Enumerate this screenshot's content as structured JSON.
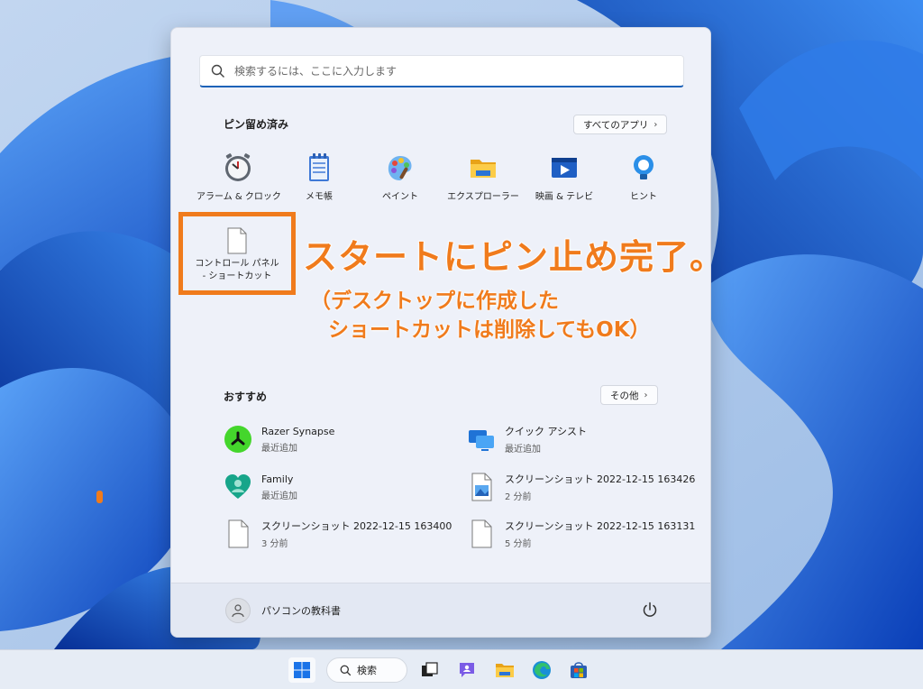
{
  "start_menu": {
    "search_placeholder": "検索するには、ここに入力します",
    "pinned": {
      "title": "ピン留め済み",
      "all_apps_label": "すべてのアプリ",
      "items": [
        {
          "label": "アラーム & クロック",
          "icon": "alarm-clock-icon"
        },
        {
          "label": "メモ帳",
          "icon": "notepad-icon"
        },
        {
          "label": "ペイント",
          "icon": "paint-icon"
        },
        {
          "label": "エクスプローラー",
          "icon": "folder-icon"
        },
        {
          "label": "映画 & テレビ",
          "icon": "movies-tv-icon"
        },
        {
          "label": "ヒント",
          "icon": "tips-lightbulb-icon"
        }
      ],
      "shortcut": {
        "label_line1": "コントロール パネル",
        "label_line2": "- ショートカット",
        "icon": "file-icon"
      }
    },
    "recommended": {
      "title": "おすすめ",
      "more_label": "その他",
      "items": [
        {
          "name": "Razer Synapse",
          "sub": "最近追加",
          "icon": "razer-icon"
        },
        {
          "name": "クイック アシスト",
          "sub": "最近追加",
          "icon": "quick-assist-icon"
        },
        {
          "name": "Family",
          "sub": "最近追加",
          "icon": "family-heart-icon"
        },
        {
          "name": "スクリーンショット 2022-12-15 163426",
          "sub": "2 分前",
          "icon": "image-file-icon"
        },
        {
          "name": "スクリーンショット 2022-12-15 163400",
          "sub": "3 分前",
          "icon": "file-icon"
        },
        {
          "name": "スクリーンショット 2022-12-15 163131",
          "sub": "5 分前",
          "icon": "file-icon"
        }
      ]
    },
    "footer": {
      "user_name": "パソコンの教科書"
    }
  },
  "annotation": {
    "main": "スタートにピン止め完了。",
    "sub_line1": "（デスクトップに作成した",
    "sub_line2": "ショートカットは削除してもOK）"
  },
  "taskbar": {
    "search_label": "検索"
  },
  "colors": {
    "accent": "#1d62b8",
    "annotation": "#f07b1c"
  }
}
